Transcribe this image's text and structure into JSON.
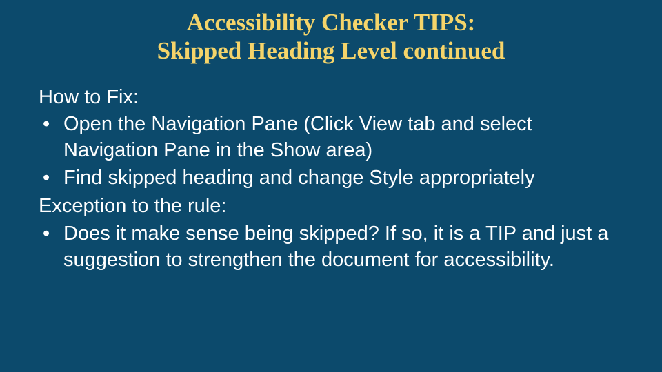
{
  "slide": {
    "title_line1": "Accessibility Checker TIPS:",
    "title_line2": "Skipped Heading Level continued",
    "how_to_fix_label": "How to Fix:",
    "fix_bullets": [
      "Open the Navigation Pane (Click View tab and select Navigation Pane in the Show area)",
      "Find skipped heading and change Style appropriately"
    ],
    "exception_label": "Exception to the rule:",
    "exception_bullets": [
      "Does it make sense being skipped? If so, it is a TIP and just a suggestion to strengthen the document for accessibility."
    ]
  }
}
